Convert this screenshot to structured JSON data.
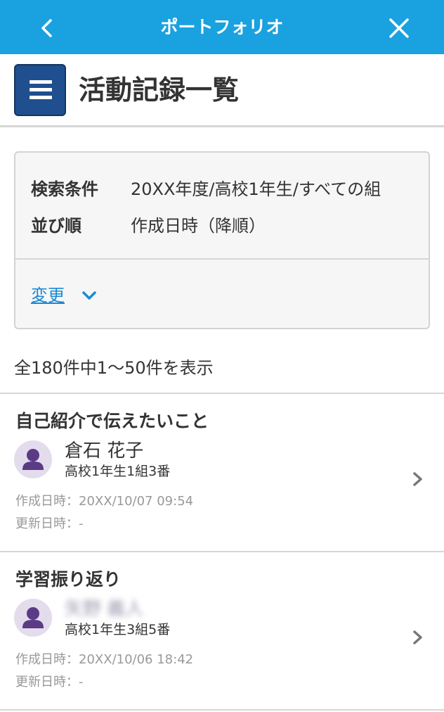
{
  "header": {
    "title": "ポートフォリオ",
    "back_icon": "chevron-left-icon",
    "close_icon": "close-icon",
    "bar_color": "#1aa1e0"
  },
  "page": {
    "title": "活動記録一覧",
    "menu_icon": "hamburger-menu-icon",
    "menu_color": "#1f4f8e"
  },
  "conditions": {
    "search_label": "検索条件",
    "search_value": "20XX年度/高校1年生/すべての組",
    "sort_label": "並び順",
    "sort_value": "作成日時（降順）",
    "change_label": "変更",
    "change_icon": "chevron-down-icon",
    "link_color": "#1a8ad4"
  },
  "result_count": "全180件中1〜50件を表示",
  "records": [
    {
      "title": "自己紹介で伝えたいこと",
      "student_name": "倉石 花子",
      "student_class": "高校1年生1組3番",
      "created": "作成日時：20XX/10/07 09:54",
      "updated": "更新日時：-"
    },
    {
      "title": "学習振り返り",
      "student_name": "矢野 義人",
      "student_class": "高校1年生3組5番",
      "created": "作成日時：20XX/10/06 18:42",
      "updated": "更新日時：-"
    }
  ]
}
